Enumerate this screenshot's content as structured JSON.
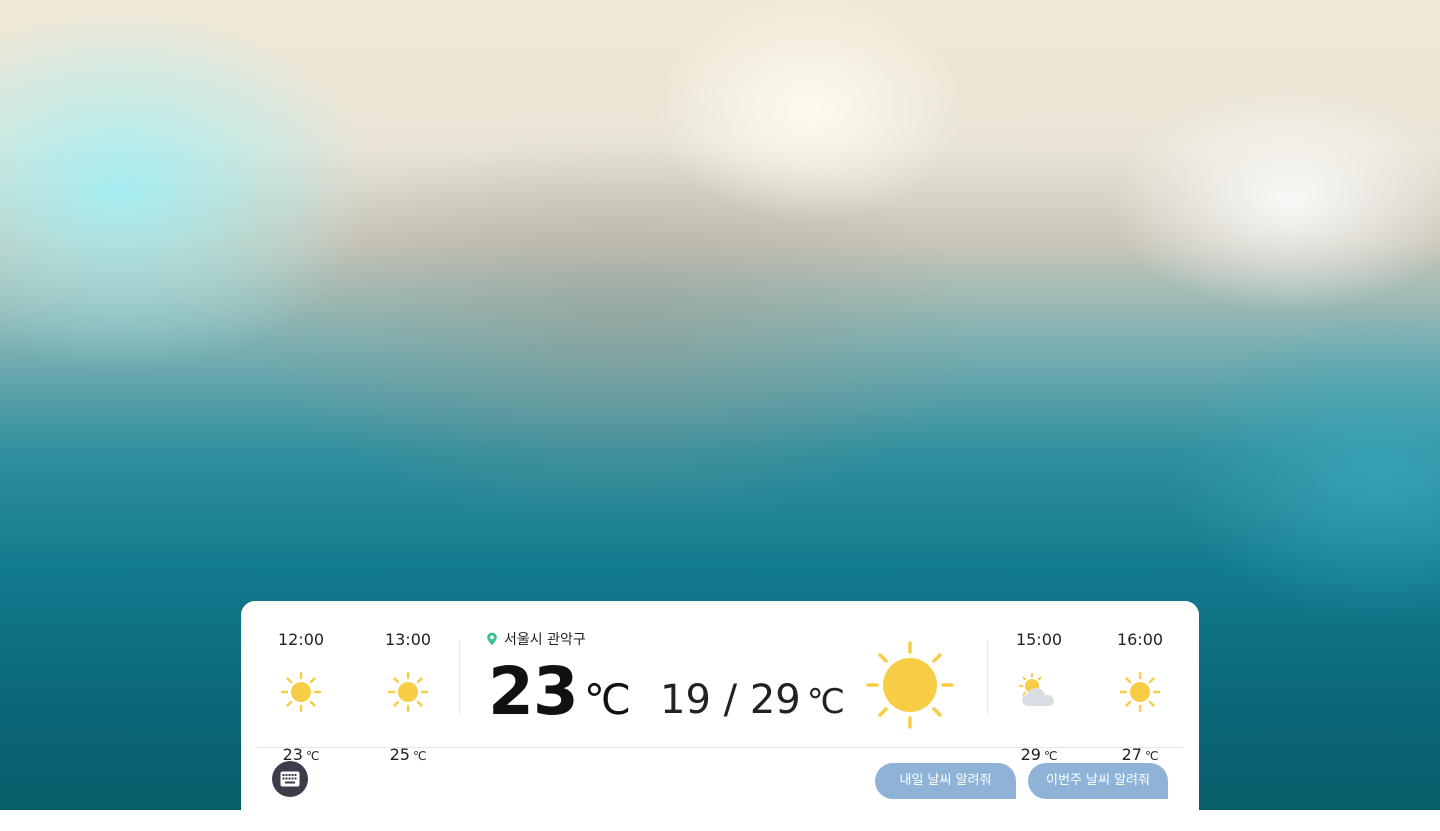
{
  "location": {
    "name": "서울시 관악구",
    "icon": "location-pin-icon",
    "color": "#3ec28f"
  },
  "current": {
    "temp": "23",
    "unit": "℃",
    "low": "19",
    "separator": "/",
    "high": "29",
    "range_unit": "℃",
    "icon": "sun-icon"
  },
  "hourly_left": [
    {
      "time": "12:00",
      "temp": "23",
      "unit": "℃",
      "icon": "sun-icon"
    },
    {
      "time": "13:00",
      "temp": "25",
      "unit": "℃",
      "icon": "sun-icon"
    }
  ],
  "hourly_right": [
    {
      "time": "15:00",
      "temp": "29",
      "unit": "℃",
      "icon": "partly-cloudy-icon"
    },
    {
      "time": "16:00",
      "temp": "27",
      "unit": "℃",
      "icon": "sun-icon"
    }
  ],
  "suggestions": {
    "tomorrow": "내일 날씨 알려줘",
    "this_week": "이번주 날씨 알려줘"
  },
  "colors": {
    "sun": "#f7cd45",
    "cloud": "#d9dde3",
    "chip": "#8fb3d6",
    "keyboard_button": "#3b3d48"
  }
}
